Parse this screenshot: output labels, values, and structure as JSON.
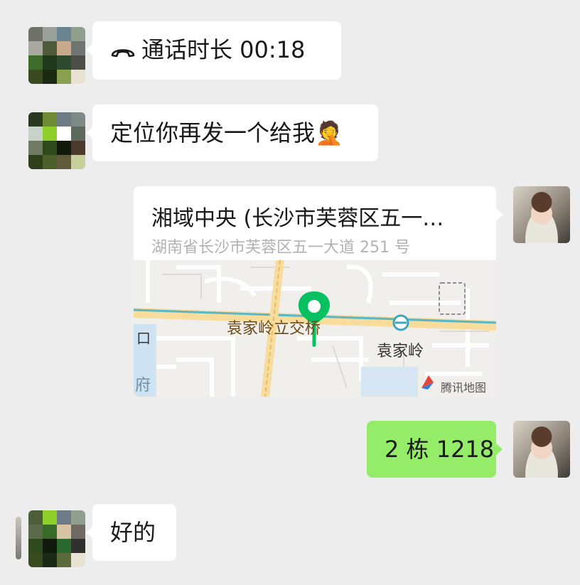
{
  "messages": {
    "call": {
      "icon": "phone-hangup-icon",
      "text": "通话时长 00:18"
    },
    "msg1": {
      "text": "定位你再发一个给我🤦"
    },
    "location": {
      "title": "湘域中央 (长沙市芙蓉区五一…",
      "address": "湖南省长沙市芙蓉区五一大道 251 号",
      "map": {
        "place_label_1": "袁家岭立交桥",
        "place_label_2": "袁家岭",
        "place_label_3": "府",
        "place_label_4": "口",
        "provider": "腾讯地图",
        "pin_color": "#07c160"
      }
    },
    "msg2": {
      "text": "2 栋 1218"
    },
    "msg3": {
      "text": "好的"
    }
  },
  "colors": {
    "background": "#ededed",
    "incoming_bubble": "#ffffff",
    "outgoing_bubble": "#95ec69",
    "secondary_text": "#b2b2b2"
  }
}
